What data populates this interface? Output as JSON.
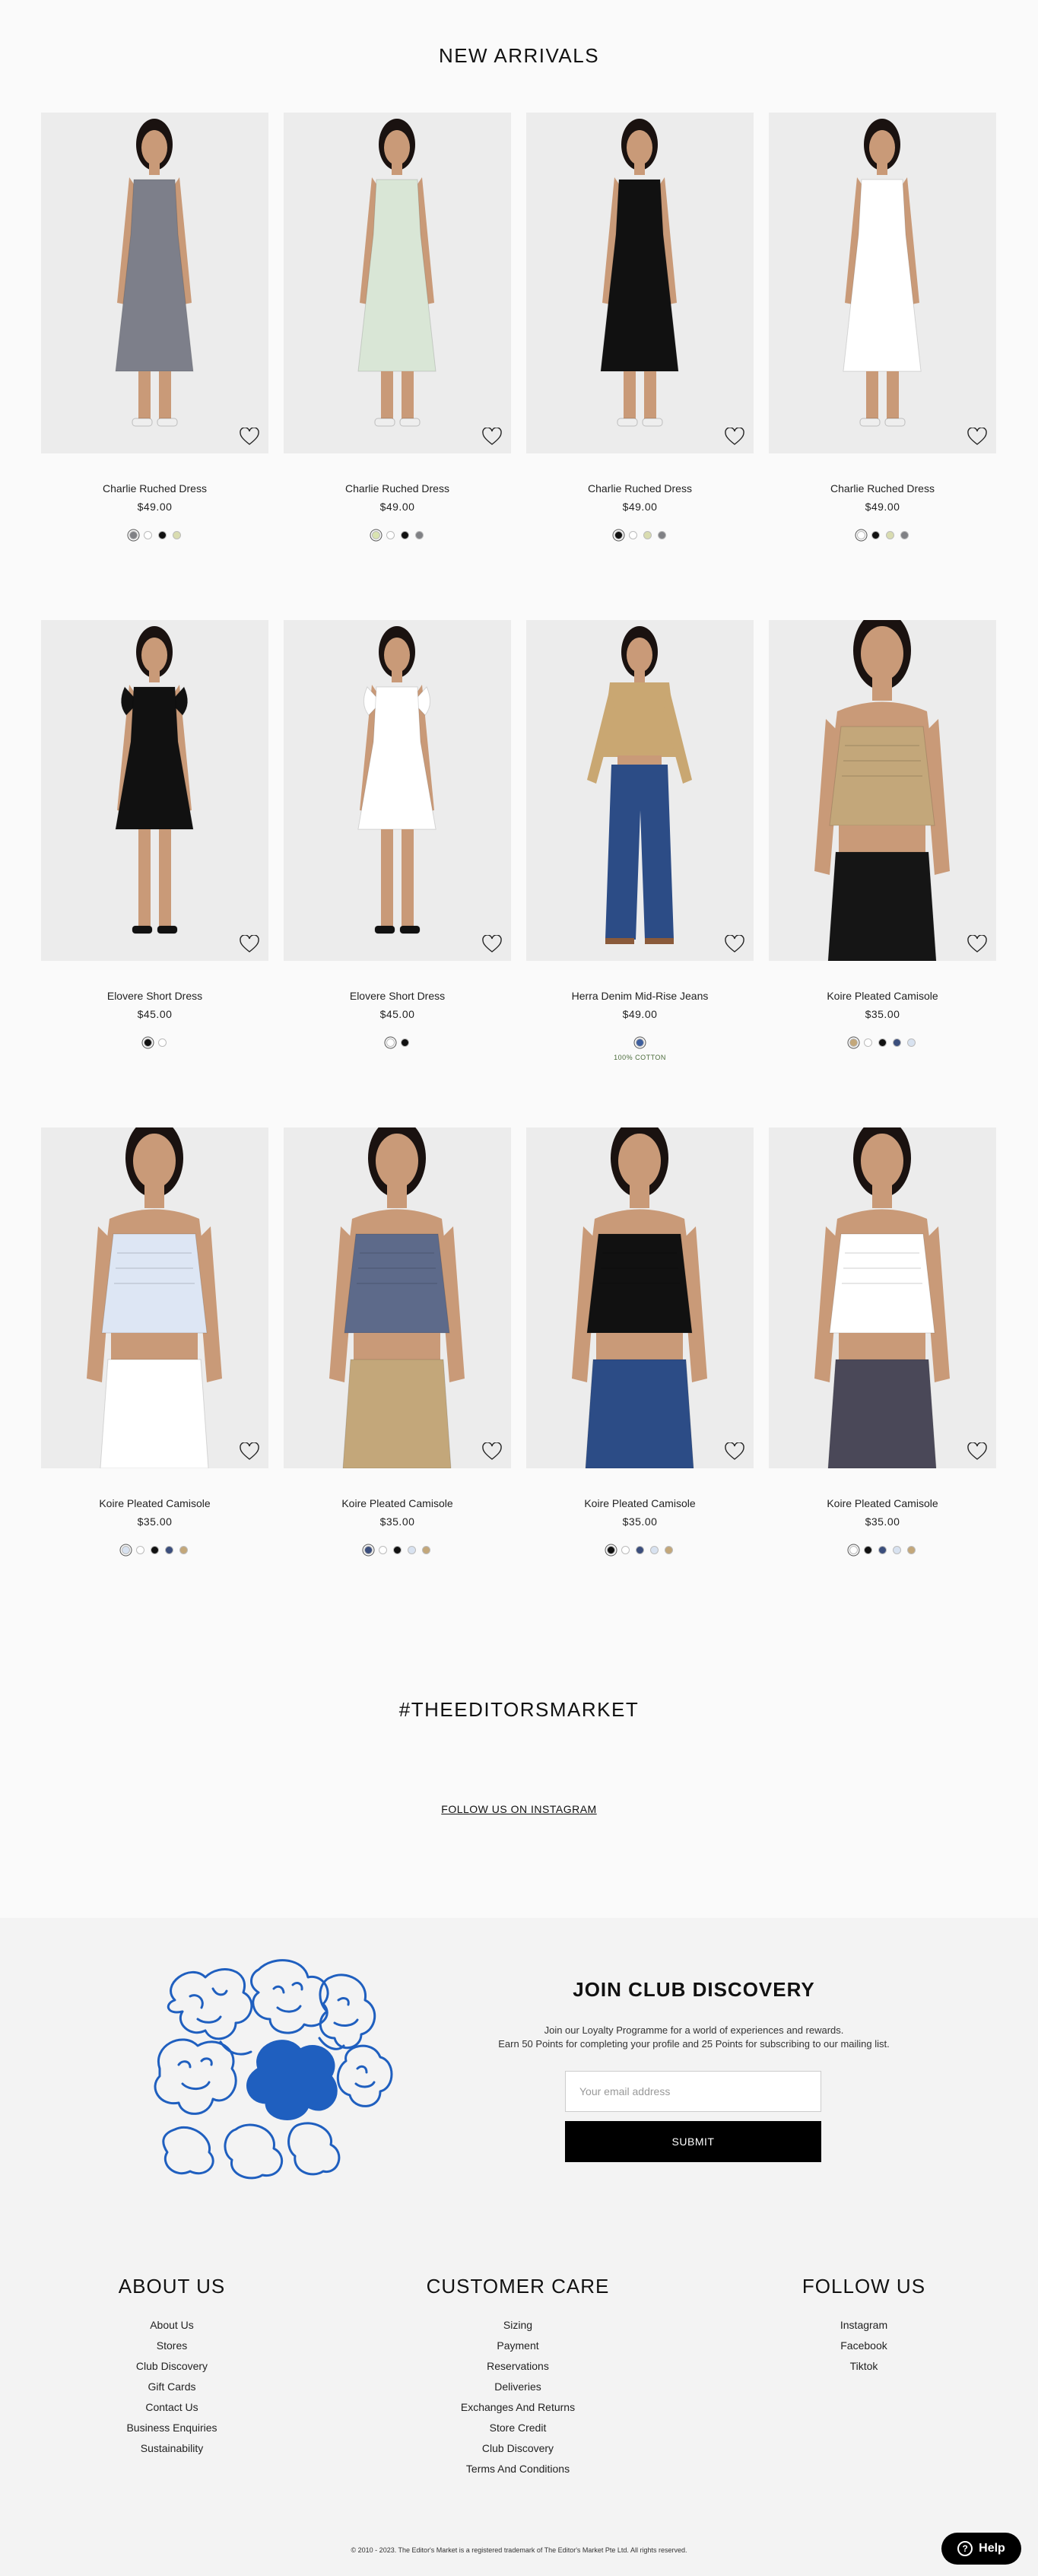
{
  "new_arrivals": {
    "title": "NEW ARRIVALS",
    "products": [
      {
        "name": "Charlie Ruched Dress",
        "price": "$49.00",
        "badge": "",
        "top_color": "#7d7f8a",
        "bottom_color": "#7d7f8a",
        "style": "dress",
        "swatches": [
          "#808185",
          "#ffffff",
          "#111111",
          "#d9dcb0"
        ],
        "selected": 0
      },
      {
        "name": "Charlie Ruched Dress",
        "price": "$49.00",
        "badge": "",
        "top_color": "#d9e6d6",
        "bottom_color": "#d9e6d6",
        "style": "dress",
        "swatches": [
          "#d9e3b0",
          "#ffffff",
          "#111111",
          "#808185"
        ],
        "selected": 0
      },
      {
        "name": "Charlie Ruched Dress",
        "price": "$49.00",
        "badge": "",
        "top_color": "#111111",
        "bottom_color": "#111111",
        "style": "dress",
        "swatches": [
          "#111111",
          "#ffffff",
          "#d9dcb0",
          "#808185"
        ],
        "selected": 0
      },
      {
        "name": "Charlie Ruched Dress",
        "price": "$49.00",
        "badge": "",
        "top_color": "#ffffff",
        "bottom_color": "#ffffff",
        "style": "dress",
        "swatches": [
          "#ffffff",
          "#111111",
          "#d9dcb0",
          "#808185"
        ],
        "selected": 0
      },
      {
        "name": "Elovere Short Dress",
        "price": "$45.00",
        "badge": "",
        "top_color": "#111111",
        "bottom_color": "#111111",
        "style": "short",
        "swatches": [
          "#111111",
          "#ffffff"
        ],
        "selected": 0
      },
      {
        "name": "Elovere Short Dress",
        "price": "$45.00",
        "badge": "",
        "top_color": "#ffffff",
        "bottom_color": "#ffffff",
        "style": "short",
        "swatches": [
          "#ffffff",
          "#111111"
        ],
        "selected": 0
      },
      {
        "name": "Herra Denim Mid-Rise Jeans",
        "price": "$49.00",
        "badge": "100% COTTON",
        "top_color": "#c9a772",
        "bottom_color": "#2c4c86",
        "style": "jeans",
        "swatches": [
          "#3e5f9e"
        ],
        "selected": 0
      },
      {
        "name": "Koire Pleated Camisole",
        "price": "$35.00",
        "badge": "",
        "top_color": "#c3a77a",
        "bottom_color": "#151515",
        "style": "cami",
        "swatches": [
          "#c3a77a",
          "#ffffff",
          "#111111",
          "#3b4e7c",
          "#d8e2f0"
        ],
        "selected": 0
      },
      {
        "name": "Koire Pleated Camisole",
        "price": "$35.00",
        "badge": "",
        "top_color": "#dde6f4",
        "bottom_color": "#ffffff",
        "style": "cami",
        "swatches": [
          "#d8e2f0",
          "#ffffff",
          "#111111",
          "#3b4e7c",
          "#c3a77a"
        ],
        "selected": 0
      },
      {
        "name": "Koire Pleated Camisole",
        "price": "$35.00",
        "badge": "",
        "top_color": "#5d6a8a",
        "bottom_color": "#c3a77a",
        "style": "cami",
        "swatches": [
          "#3b4e7c",
          "#ffffff",
          "#111111",
          "#d8e2f0",
          "#c3a77a"
        ],
        "selected": 0
      },
      {
        "name": "Koire Pleated Camisole",
        "price": "$35.00",
        "badge": "",
        "top_color": "#111111",
        "bottom_color": "#2c4c86",
        "style": "cami",
        "swatches": [
          "#111111",
          "#ffffff",
          "#3b4e7c",
          "#d8e2f0",
          "#c3a77a"
        ],
        "selected": 0
      },
      {
        "name": "Koire Pleated Camisole",
        "price": "$35.00",
        "badge": "",
        "top_color": "#ffffff",
        "bottom_color": "#4a4858",
        "style": "cami",
        "swatches": [
          "#ffffff",
          "#111111",
          "#3b4e7c",
          "#d8e2f0",
          "#c3a77a"
        ],
        "selected": 0
      }
    ]
  },
  "instagram": {
    "hashtag": "#THEEDITORSMARKET",
    "follow_label": "FOLLOW US ON INSTAGRAM"
  },
  "club": {
    "title": "JOIN CLUB DISCOVERY",
    "desc_line1": "Join our Loyalty Programme for a world of experiences and rewards.",
    "desc_line2": "Earn 50 Points for completing your profile and 25 Points for subscribing to our mailing list.",
    "email_placeholder": "Your email address",
    "submit_label": "SUBMIT",
    "art_color": "#1f5fbf"
  },
  "footer": {
    "about": {
      "title": "ABOUT US",
      "links": [
        "About Us",
        "Stores",
        "Club Discovery",
        "Gift Cards",
        "Contact Us",
        "Business Enquiries",
        "Sustainability"
      ]
    },
    "care": {
      "title": "CUSTOMER CARE",
      "links": [
        "Sizing",
        "Payment",
        "Reservations",
        "Deliveries",
        "Exchanges And Returns",
        "Store Credit",
        "Club Discovery",
        "Terms And Conditions"
      ]
    },
    "follow": {
      "title": "FOLLOW US",
      "links": [
        "Instagram",
        "Facebook",
        "Tiktok"
      ]
    },
    "copyright": "© 2010 - 2023. The Editor's Market is a registered trademark of The Editor's Market Pte Ltd. All rights reserved."
  },
  "help": {
    "label": "Help",
    "icon": "question-icon"
  }
}
